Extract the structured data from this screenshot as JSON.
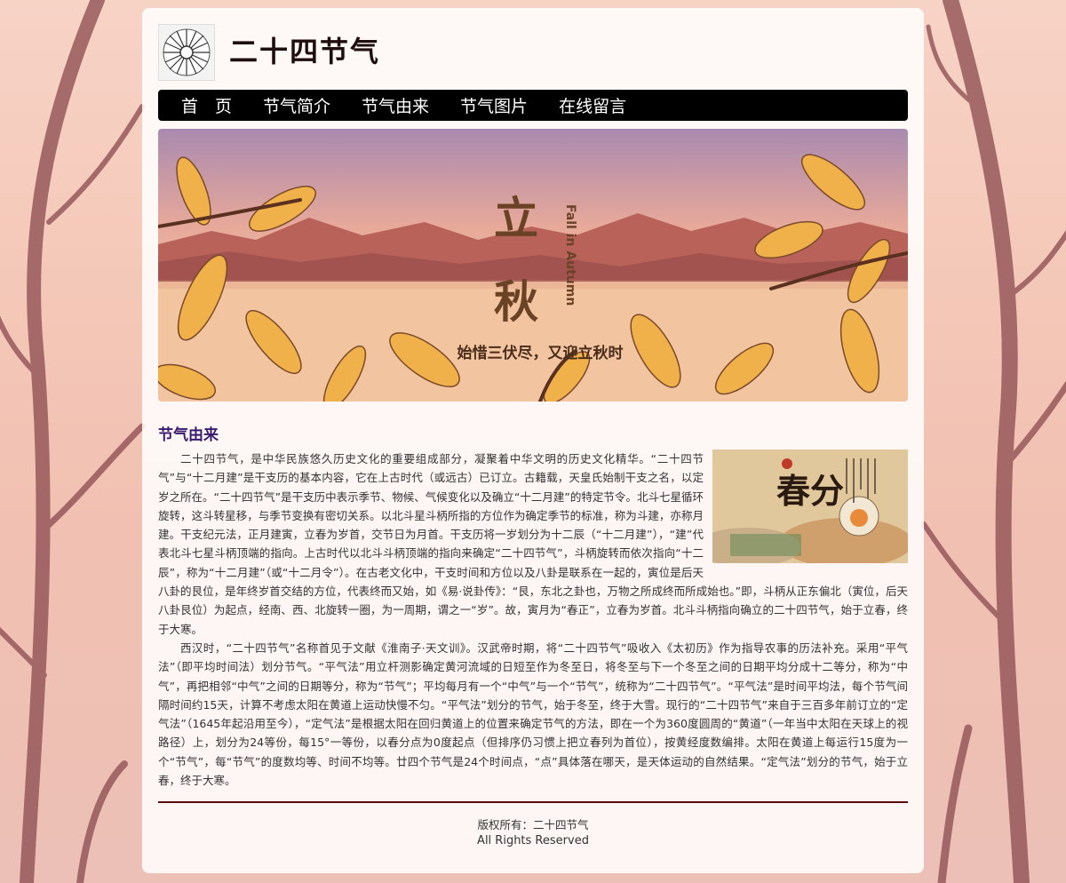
{
  "site": {
    "title": "二十四节气"
  },
  "nav": {
    "items": [
      "首　页",
      "节气简介",
      "节气由来",
      "节气图片",
      "在线留言"
    ]
  },
  "banner": {
    "headline_1": "立",
    "headline_2": "秋",
    "subtitle_en": "Fall in Autumn",
    "caption": "始惜三伏尽，又迎立秋时"
  },
  "thumb": {
    "headline": "春分"
  },
  "section": {
    "title": "节气由来"
  },
  "article": {
    "p1": "二十四节气，是中华民族悠久历史文化的重要组成部分，凝聚着中华文明的历史文化精华。“二十四节气”与“十二月建”是干支历的基本内容，它在上古时代（或远古）已订立。古籍载，天皇氏始制干支之名，以定岁之所在。“二十四节气”是干支历中表示季节、物候、气候变化以及确立“十二月建”的特定节令。北斗七星循环旋转，这斗转星移，与季节变换有密切关系。以北斗星斗柄所指的方位作为确定季节的标准，称为斗建，亦称月建。干支纪元法，正月建寅，立春为岁首，交节日为月首。干支历将一岁划分为十二辰（“十二月建”），“建”代表北斗七星斗柄顶端的指向。上古时代以北斗斗柄顶端的指向来确定“二十四节气”，斗柄旋转而依次指向“十二辰”，称为“十二月建”（或“十二月令”）。在古老文化中，干支时间和方位以及八卦是联系在一起的，寅位是后天八卦的艮位，是年终岁首交结的方位，代表终而又始，如《易·说卦传》：“艮，东北之卦也，万物之所成终而所成始也。”即，斗柄从正东偏北（寅位，后天八卦艮位）为起点，经南、西、北旋转一圈，为一周期，谓之一“岁”。故，寅月为“春正”，立春为岁首。北斗斗柄指向确立的二十四节气，始于立春，终于大寒。",
    "p2": "西汉时，“二十四节气”名称首见于文献《淮南子·天文训》。汉武帝时期，将“二十四节气”吸收入《太初历》作为指导农事的历法补充。采用“平气法”（即平均时间法）划分节气。“平气法”用立杆测影确定黄河流域的日短至作为冬至日，将冬至与下一个冬至之间的日期平均分成十二等分，称为“中气”，再把相邻“中气”之间的日期等分，称为“节气”；平均每月有一个“中气”与一个“节气”，统称为“二十四节气”。“平气法”是时间平均法，每个节气间隔时间约15天，计算不考虑太阳在黄道上运动快慢不匀。“平气法”划分的节气，始于冬至，终于大雪。现行的“二十四节气”来自于三百多年前订立的“定气法”（1645年起沿用至今），“定气法”是根据太阳在回归黄道上的位置来确定节气的方法，即在一个为360度圆周的“黄道”（一年当中太阳在天球上的视路径）上，划分为24等份，每15°一等份，以春分点为0度起点（但排序仍习惯上把立春列为首位），按黄经度数编排。太阳在黄道上每运行15度为一个“节气”，每“节气”的度数均等、时间不均等。廿四个节气是24个时间点，“点”具体落在哪天，是天体运动的自然结果。“定气法”划分的节气，始于立春，终于大寒。"
  },
  "footer": {
    "copyright": "版权所有：二十四节气",
    "rights": "All Rights Reserved"
  }
}
